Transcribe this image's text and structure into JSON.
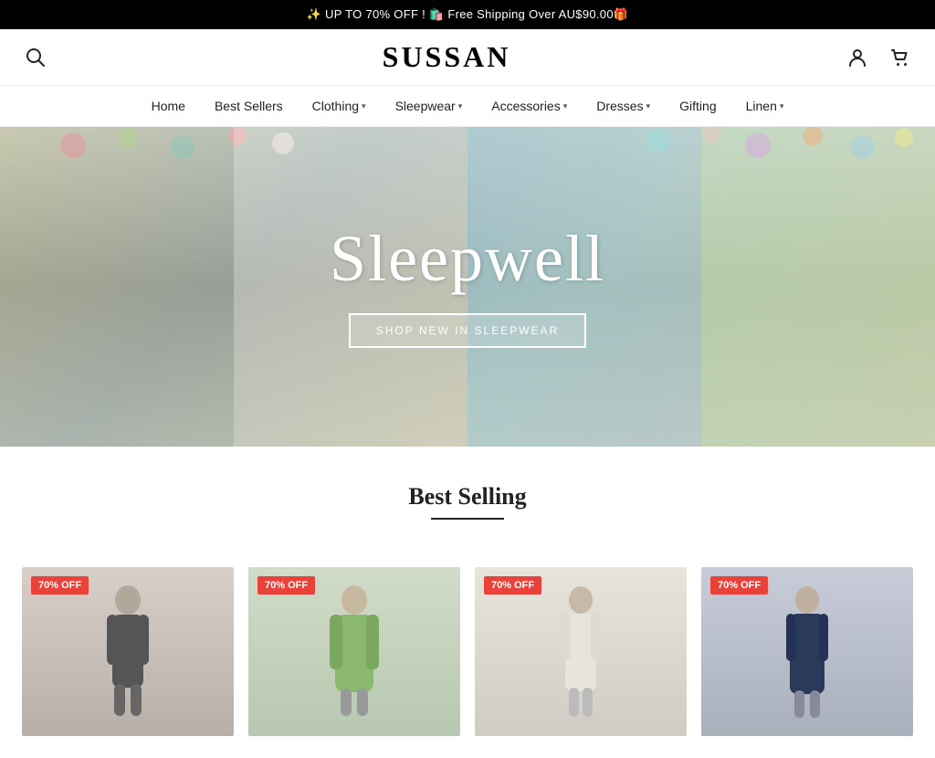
{
  "announcement": {
    "text": "✨ UP TO 70% OFF ! 🛍️ Free Shipping Over AU$90.00🎁"
  },
  "header": {
    "logo": "SUSSAN",
    "search_label": "Search",
    "account_label": "Account",
    "cart_label": "Cart"
  },
  "nav": {
    "items": [
      {
        "label": "Home",
        "has_dropdown": false
      },
      {
        "label": "Best Sellers",
        "has_dropdown": false
      },
      {
        "label": "Clothing",
        "has_dropdown": true
      },
      {
        "label": "Sleepwear",
        "has_dropdown": true
      },
      {
        "label": "Accessories",
        "has_dropdown": true
      },
      {
        "label": "Dresses",
        "has_dropdown": true
      },
      {
        "label": "Gifting",
        "has_dropdown": false
      },
      {
        "label": "Linen",
        "has_dropdown": true
      }
    ]
  },
  "hero": {
    "title": "Sleepwell",
    "cta_label": "SHOP NEW IN SLEEPWEAR"
  },
  "best_selling": {
    "title": "Best Selling",
    "products": [
      {
        "badge": "70% OFF",
        "alt": "Black dress product"
      },
      {
        "badge": "70% OFF",
        "alt": "Floral robe product"
      },
      {
        "badge": "70% OFF",
        "alt": "White dress product"
      },
      {
        "badge": "70% OFF",
        "alt": "Navy dress product"
      }
    ]
  },
  "colors": {
    "sale_badge": "#e8423a",
    "nav_border": "#eeeeee",
    "accent_underline": "#222222"
  }
}
